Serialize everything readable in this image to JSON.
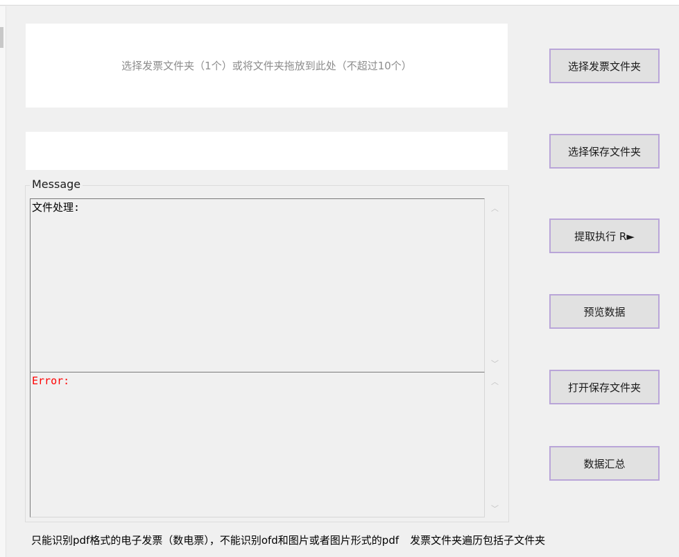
{
  "drop_zone": {
    "hint": "选择发票文件夹（1个）或将文件夹拖放到此处（不超过10个）"
  },
  "save_path": {
    "value": ""
  },
  "message_group": {
    "legend": "Message",
    "message_text": "文件处理:",
    "error_text": "Error:"
  },
  "buttons": {
    "select_invoice_folder": "选择发票文件夹",
    "select_save_folder": "选择保存文件夹",
    "extract_execute": "提取执行 R►",
    "preview_data": "预览数据",
    "open_save_folder": "打开保存文件夹",
    "data_summary": "数据汇总"
  },
  "footer": {
    "note_format": "只能识别pdf格式的电子发票（数电票），不能识别ofd和图片或者图片形式的pdf",
    "note_recursive": "发票文件夹遍历包括子文件夹"
  },
  "icons": {
    "scroll_up": "︿",
    "scroll_down": "﹀"
  },
  "colors": {
    "button_border": "#b9a5d8",
    "error_text": "#ff0000"
  }
}
